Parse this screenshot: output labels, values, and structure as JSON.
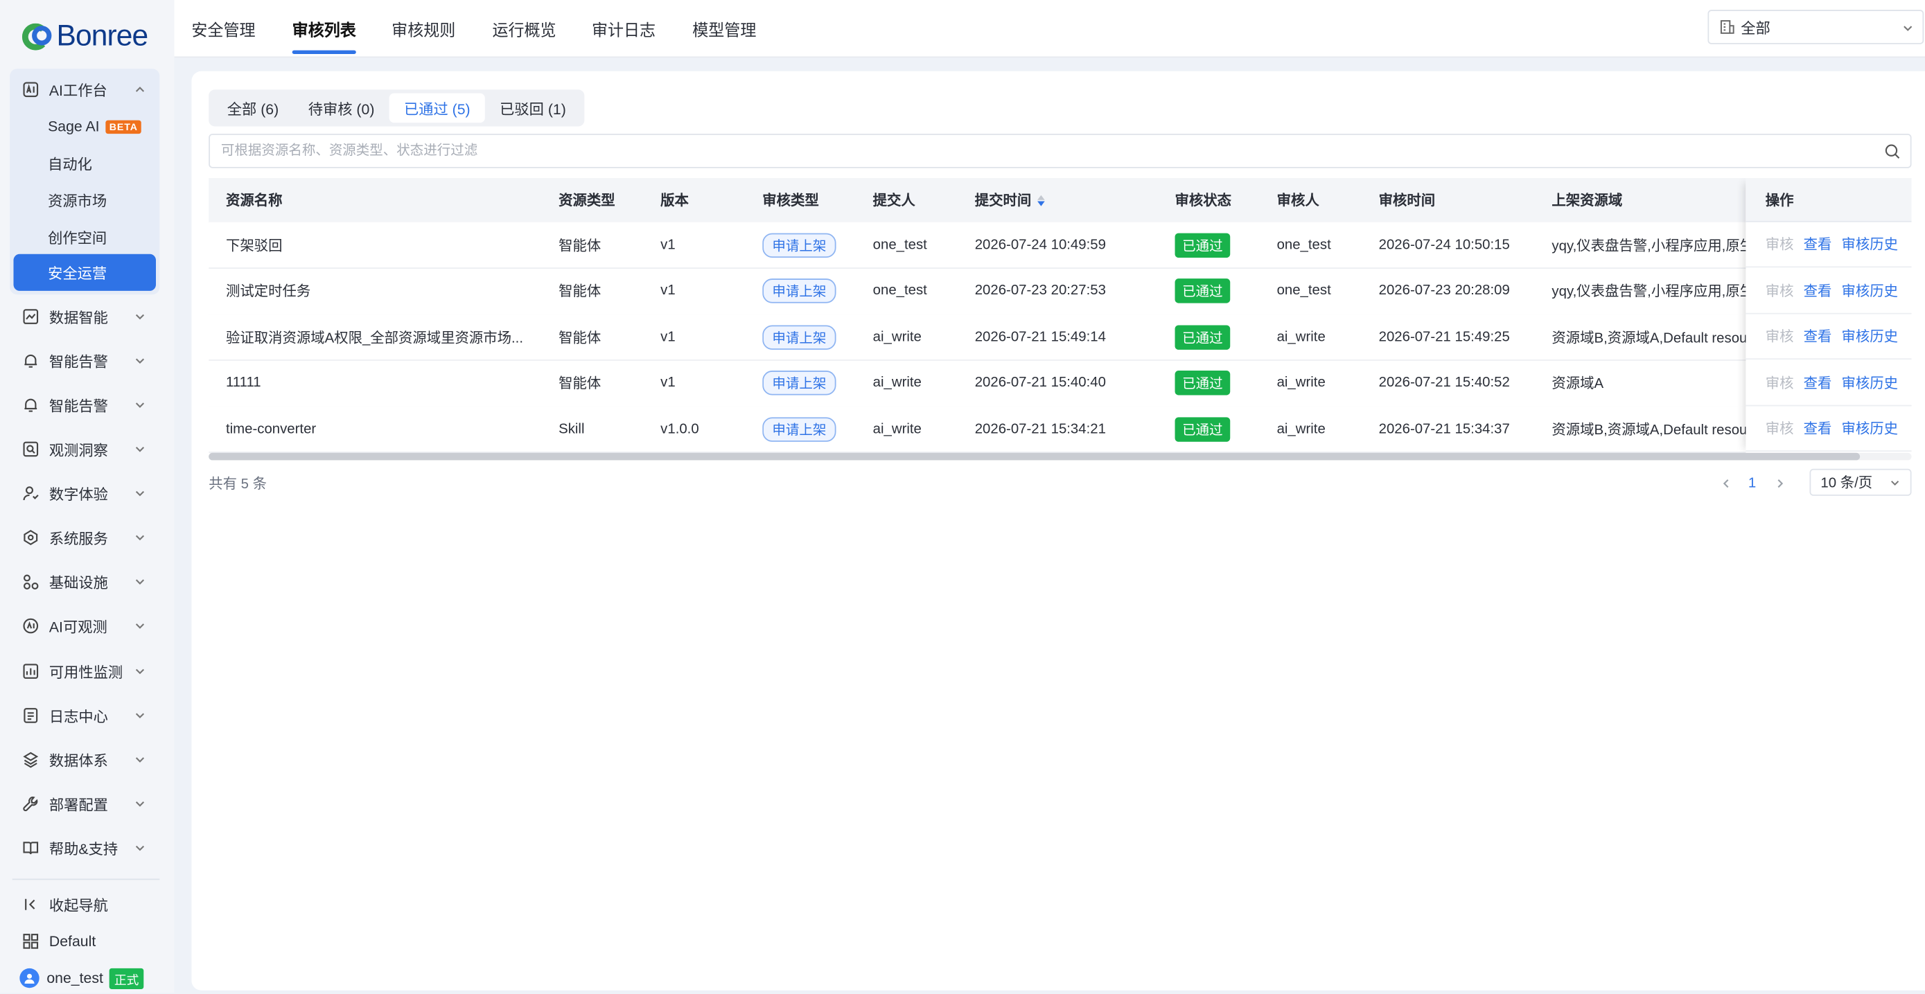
{
  "brand": {
    "logo_text": "Bonree"
  },
  "sidebar": {
    "ai_group": {
      "label": "AI工作台",
      "items": [
        {
          "label": "Sage AI",
          "badge": "BETA"
        },
        {
          "label": "自动化"
        },
        {
          "label": "资源市场"
        },
        {
          "label": "创作空间"
        },
        {
          "label": "安全运营",
          "active": true
        }
      ]
    },
    "items": [
      {
        "label": "数据智能",
        "icon": "chart-line-icon"
      },
      {
        "label": "智能告警",
        "icon": "bell-icon"
      },
      {
        "label": "智能告警",
        "icon": "bell-icon"
      },
      {
        "label": "观测洞察",
        "icon": "magnifier-icon"
      },
      {
        "label": "数字体验",
        "icon": "user-experience-icon"
      },
      {
        "label": "系统服务",
        "icon": "service-icon"
      },
      {
        "label": "基础设施",
        "icon": "infrastructure-icon"
      },
      {
        "label": "AI可观测",
        "icon": "ai-observe-icon"
      },
      {
        "label": "可用性监测",
        "icon": "availability-icon"
      },
      {
        "label": "日志中心",
        "icon": "log-icon"
      },
      {
        "label": "数据体系",
        "icon": "data-system-icon"
      },
      {
        "label": "部署配置",
        "icon": "wrench-icon"
      },
      {
        "label": "帮助&支持",
        "icon": "book-icon"
      }
    ],
    "footer": {
      "collapse_label": "收起导航",
      "workspace_label": "Default",
      "user_name": "one_test",
      "user_badge": "正式"
    }
  },
  "topbar": {
    "tabs": [
      {
        "label": "安全管理"
      },
      {
        "label": "审核列表",
        "active": true
      },
      {
        "label": "审核规则"
      },
      {
        "label": "运行概览"
      },
      {
        "label": "审计日志"
      },
      {
        "label": "模型管理"
      }
    ],
    "scope_select": {
      "value": "全部"
    }
  },
  "main": {
    "status_tabs": [
      {
        "label": "全部 (6)"
      },
      {
        "label": "待审核 (0)"
      },
      {
        "label": "已通过 (5)",
        "active": true
      },
      {
        "label": "已驳回 (1)"
      }
    ],
    "filter": {
      "placeholder": "可根据资源名称、资源类型、状态进行过滤",
      "value": ""
    },
    "table": {
      "columns": [
        "资源名称",
        "资源类型",
        "版本",
        "审核类型",
        "提交人",
        "提交时间",
        "审核状态",
        "审核人",
        "审核时间",
        "上架资源域",
        "操作"
      ],
      "rows": [
        {
          "name": "下架驳回",
          "type": "智能体",
          "version": "v1",
          "review_type": "申请上架",
          "submitter": "one_test",
          "submit_time": "2026-07-24 10:49:59",
          "status": "已通过",
          "reviewer": "one_test",
          "review_time": "2026-07-24 10:50:15",
          "domain": "yqy,仪表盘告警,小程序应用,原生"
        },
        {
          "name": "测试定时任务",
          "type": "智能体",
          "version": "v1",
          "review_type": "申请上架",
          "submitter": "one_test",
          "submit_time": "2026-07-23 20:27:53",
          "status": "已通过",
          "reviewer": "one_test",
          "review_time": "2026-07-23 20:28:09",
          "domain": "yqy,仪表盘告警,小程序应用,原生"
        },
        {
          "name": "验证取消资源域A权限_全部资源域里资源市场...",
          "type": "智能体",
          "version": "v1",
          "review_type": "申请上架",
          "submitter": "ai_write",
          "submit_time": "2026-07-21 15:49:14",
          "status": "已通过",
          "reviewer": "ai_write",
          "review_time": "2026-07-21 15:49:25",
          "domain": "资源域B,资源域A,Default resou"
        },
        {
          "name": "11111",
          "type": "智能体",
          "version": "v1",
          "review_type": "申请上架",
          "submitter": "ai_write",
          "submit_time": "2026-07-21 15:40:40",
          "status": "已通过",
          "reviewer": "ai_write",
          "review_time": "2026-07-21 15:40:52",
          "domain": "资源域A"
        },
        {
          "name": "time-converter",
          "type": "Skill",
          "version": "v1.0.0",
          "review_type": "申请上架",
          "submitter": "ai_write",
          "submit_time": "2026-07-21 15:34:21",
          "status": "已通过",
          "reviewer": "ai_write",
          "review_time": "2026-07-21 15:34:37",
          "domain": "资源域B,资源域A,Default resou"
        }
      ],
      "actions": {
        "review": "审核",
        "view": "查看",
        "history": "审核历史"
      }
    },
    "pagination": {
      "total_text": "共有 5 条",
      "current_page": "1",
      "page_size": "10 条/页"
    }
  },
  "colors": {
    "accent": "#2f73e6",
    "success": "#19b24b",
    "beta": "#f0711c",
    "sidebar_bg": "#f3f5f9"
  }
}
